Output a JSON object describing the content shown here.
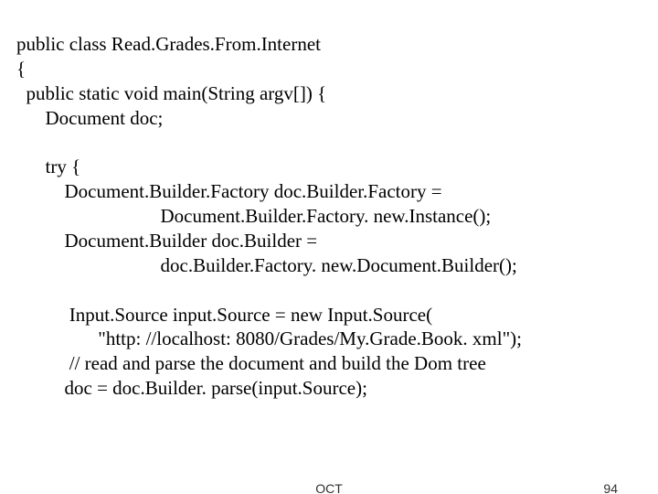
{
  "code": {
    "l01": "public class Read.Grades.From.Internet",
    "l02": "{",
    "l03": "  public static void main(String argv[]) {",
    "l04": "      Document doc;",
    "l05": "",
    "l06": "      try {",
    "l07": "          Document.Builder.Factory doc.Builder.Factory =",
    "l08": "                              Document.Builder.Factory. new.Instance();",
    "l09": "          Document.Builder doc.Builder =",
    "l10": "                              doc.Builder.Factory. new.Document.Builder();",
    "l11": "",
    "l12": "           Input.Source input.Source = new Input.Source(",
    "l13": "                 \"http: //localhost: 8080/Grades/My.Grade.Book. xml\");",
    "l14": "           // read and parse the document and build the Dom tree",
    "l15": "          doc = doc.Builder. parse(input.Source);"
  },
  "footer": {
    "center": "OCT",
    "page": "94"
  }
}
